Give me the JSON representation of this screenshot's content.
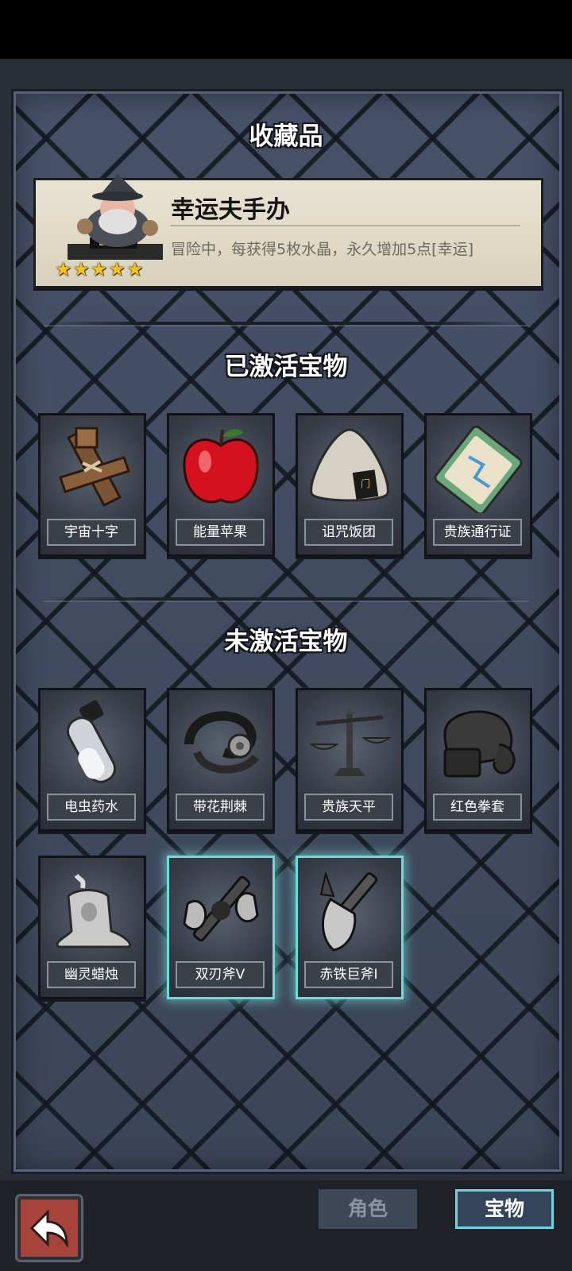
{
  "header": {
    "title": "收藏品"
  },
  "collectible": {
    "name": "幸运夫手办",
    "description": "冒险中，每获得5枚水晶，永久增加5点[幸运]",
    "stars": 5
  },
  "active_section": {
    "title": "已激活宝物",
    "items": [
      {
        "label": "宇宙十字",
        "icon": "wooden-cross-icon"
      },
      {
        "label": "能量苹果",
        "icon": "red-apple-icon"
      },
      {
        "label": "诅咒饭团",
        "icon": "rice-ball-icon"
      },
      {
        "label": "贵族通行证",
        "icon": "pass-card-icon"
      }
    ]
  },
  "inactive_section": {
    "title": "未激活宝物",
    "items": [
      {
        "label": "电虫药水",
        "icon": "potion-vial-icon"
      },
      {
        "label": "带花荆棘",
        "icon": "thorn-flower-icon"
      },
      {
        "label": "贵族天平",
        "icon": "balance-scale-icon"
      },
      {
        "label": "红色拳套",
        "icon": "boxing-glove-icon"
      },
      {
        "label": "幽灵蜡烛",
        "icon": "ghost-candle-icon"
      },
      {
        "label": "双刃斧V",
        "icon": "double-axe-icon",
        "highlighted": true
      },
      {
        "label": "赤铁巨斧I",
        "icon": "great-axe-icon",
        "highlighted": true
      }
    ]
  },
  "bottom_nav": {
    "back_icon": "back-arrow-icon",
    "tabs": [
      {
        "label": "角色",
        "active": false
      },
      {
        "label": "宝物",
        "active": true
      }
    ]
  },
  "colors": {
    "accent": "#6fdbd7",
    "star": "#f6c21c",
    "back": "#a6433b"
  }
}
